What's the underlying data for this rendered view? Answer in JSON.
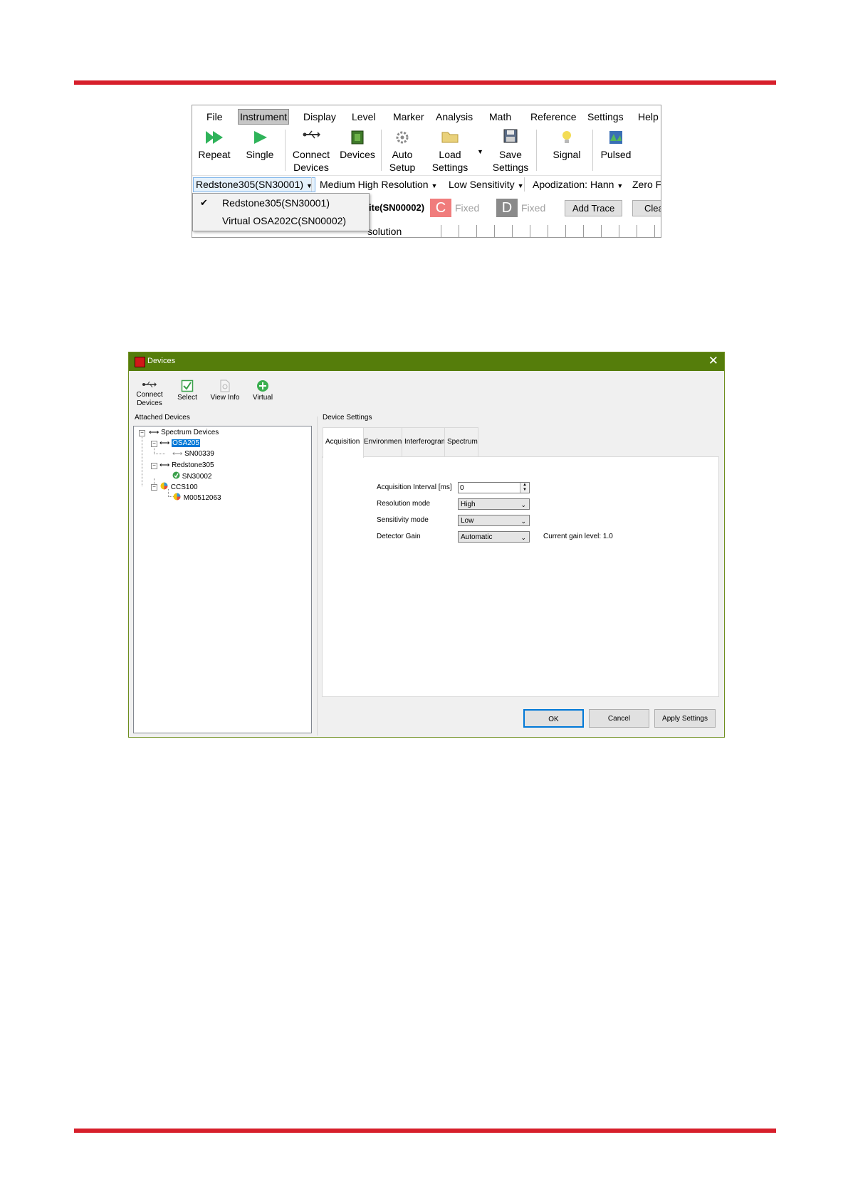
{
  "screenshot1": {
    "menu": [
      "File",
      "Instrument",
      "Display",
      "Level",
      "Marker",
      "Analysis",
      "Math",
      "Reference",
      "Settings",
      "Help"
    ],
    "active_menu": "Instrument",
    "toolbar": [
      {
        "label": "Repeat",
        "icon": "play-repeat-icon"
      },
      {
        "label": "Single",
        "icon": "play-single-icon"
      },
      {
        "label1": "Connect",
        "label2": "Devices",
        "icon": "usb-icon"
      },
      {
        "label": "Devices",
        "icon": "chip-icon"
      },
      {
        "label1": "Auto",
        "label2": "Setup",
        "icon": "auto-gear-icon",
        "badge": "Auto"
      },
      {
        "label1": "Load",
        "label2": "Settings",
        "icon": "folder-icon"
      },
      {
        "label1": "Save",
        "label2": "Settings",
        "icon": "floppy-disk-icon"
      },
      {
        "label": "Signal",
        "icon": "lightbulb-icon"
      },
      {
        "label": "Pulsed",
        "icon": "pulsed-chart-icon"
      }
    ],
    "selector": {
      "instrument": "Redstone305(SN30001)",
      "resolution": "Medium High Resolution",
      "sensitivity": "Low Sensitivity",
      "apodization": "Apodization: Hann",
      "zero_fill": "Zero F"
    },
    "dropdown_options": [
      "Redstone305(SN30001)",
      "Virtual OSA202C(SN00002)"
    ],
    "dropdown_checked_index": 0,
    "trace_row": {
      "partial_device": "ite(SN00002)",
      "trace_c_letter": "C",
      "trace_c_state": "Fixed",
      "trace_d_letter": "D",
      "trace_d_state": "Fixed",
      "add_trace": "Add Trace",
      "clear": "Clea",
      "partial_resolution": "solution"
    },
    "colors": {
      "trace_c": "#f07c7c",
      "trace_d": "#8a8a8a"
    }
  },
  "devices_dialog": {
    "title": "Devices",
    "close_glyph": "✕",
    "toolbar": [
      {
        "label1": "Connect",
        "label2": "Devices",
        "icon": "usb-icon"
      },
      {
        "label": "Select",
        "icon": "checkbox-icon"
      },
      {
        "label": "View Info",
        "icon": "document-icon"
      },
      {
        "label": "Virtual",
        "icon": "plus-circle-icon"
      }
    ],
    "attached_devices_label": "Attached Devices",
    "device_settings_label": "Device Settings",
    "tree": {
      "root": "Spectrum Devices",
      "nodes": [
        {
          "label": "OSA205",
          "selected": true,
          "children": [
            "SN00339"
          ]
        },
        {
          "label": "Redstone305",
          "children": [
            "SN30002"
          ]
        },
        {
          "label": "CCS100",
          "children": [
            "M00512063"
          ]
        }
      ]
    },
    "tabs": [
      "Acquisition",
      "Environment",
      "Interferogram",
      "Spectrum"
    ],
    "active_tab": "Acquisition",
    "form": {
      "acq_interval_label": "Acquisition Interval [ms]",
      "acq_interval_value": "0",
      "resolution_label": "Resolution mode",
      "resolution_value": "High",
      "sensitivity_label": "Sensitivity mode",
      "sensitivity_value": "Low",
      "gain_label": "Detector Gain",
      "gain_value": "Automatic",
      "gain_level_text": "Current gain level: 1.0"
    },
    "buttons": {
      "ok": "OK",
      "cancel": "Cancel",
      "apply": "Apply Settings"
    },
    "colors": {
      "titlebar": "#557d0b",
      "selection": "#0078d7"
    }
  }
}
